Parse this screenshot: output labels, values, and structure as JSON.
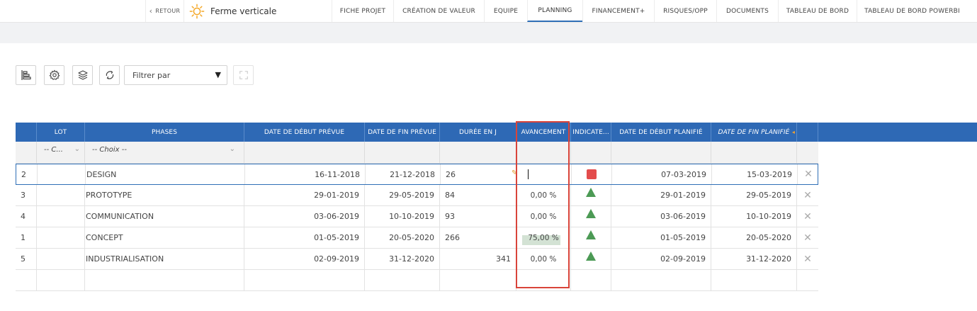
{
  "nav": {
    "back_label": "RETOUR",
    "project_title": "Ferme verticale",
    "tabs": [
      {
        "label": "FICHE PROJET"
      },
      {
        "label": "CRÉATION DE VALEUR"
      },
      {
        "label": "EQUIPE"
      },
      {
        "label": "PLANNING"
      },
      {
        "label": "FINANCEMENT+"
      },
      {
        "label": "RISQUES/OPP"
      },
      {
        "label": "DOCUMENTS"
      },
      {
        "label": "TABLEAU DE BORD"
      },
      {
        "label": "TABLEAU DE BORD POWERBI"
      }
    ],
    "active_tab": "PLANNING"
  },
  "toolbar": {
    "filter_label": "Filtrer par",
    "icons": [
      "gantt-icon",
      "settings-icon",
      "layers-icon",
      "refresh-icon",
      "fullscreen-icon"
    ]
  },
  "grid": {
    "columns": [
      "LOT",
      "PHASES",
      "DATE DE DÉBUT PRÉVUE",
      "DATE DE FIN PRÉVUE",
      "DURÉE EN J",
      "AVANCEMENT",
      "INDICATE...",
      "DATE DE DÉBUT PLANIFIÉ",
      "DATE DE FIN PLANIFIÉ"
    ],
    "filters": {
      "lot": "-- C...",
      "phases": "-- Choix --"
    },
    "rows": [
      {
        "num": "2",
        "lot": "",
        "phase": "DESIGN",
        "start": "16-11-2018",
        "end": "21-12-2018",
        "duration": "26",
        "progress": "",
        "progress_value": null,
        "indicator": "red-square",
        "plan_start": "07-03-2019",
        "plan_end": "15-03-2019"
      },
      {
        "num": "3",
        "lot": "",
        "phase": "PROTOTYPE",
        "start": "29-01-2019",
        "end": "29-05-2019",
        "duration": "84",
        "progress": "0,00 %",
        "progress_value": 0,
        "indicator": "green-triangle",
        "plan_start": "29-01-2019",
        "plan_end": "29-05-2019"
      },
      {
        "num": "4",
        "lot": "",
        "phase": "COMMUNICATION",
        "start": "03-06-2019",
        "end": "10-10-2019",
        "duration": "93",
        "progress": "0,00 %",
        "progress_value": 0,
        "indicator": "green-triangle",
        "plan_start": "03-06-2019",
        "plan_end": "10-10-2019"
      },
      {
        "num": "1",
        "lot": "",
        "phase": "CONCEPT",
        "start": "01-05-2019",
        "end": "20-05-2020",
        "duration": "266",
        "progress": "75,00 %",
        "progress_value": 75,
        "indicator": "green-triangle",
        "plan_start": "01-05-2019",
        "plan_end": "20-05-2020"
      },
      {
        "num": "5",
        "lot": "",
        "phase": "INDUSTRIALISATION",
        "start": "02-09-2019",
        "end": "31-12-2020",
        "duration": "341",
        "progress": "0,00 %",
        "progress_value": 0,
        "indicator": "green-triangle",
        "plan_start": "02-09-2019",
        "plan_end": "31-12-2020"
      }
    ],
    "colors": {
      "header": "#2e69b5",
      "indicator_red": "#e34c4c",
      "indicator_green": "#4c9a55",
      "highlight": "#d9443a"
    }
  }
}
